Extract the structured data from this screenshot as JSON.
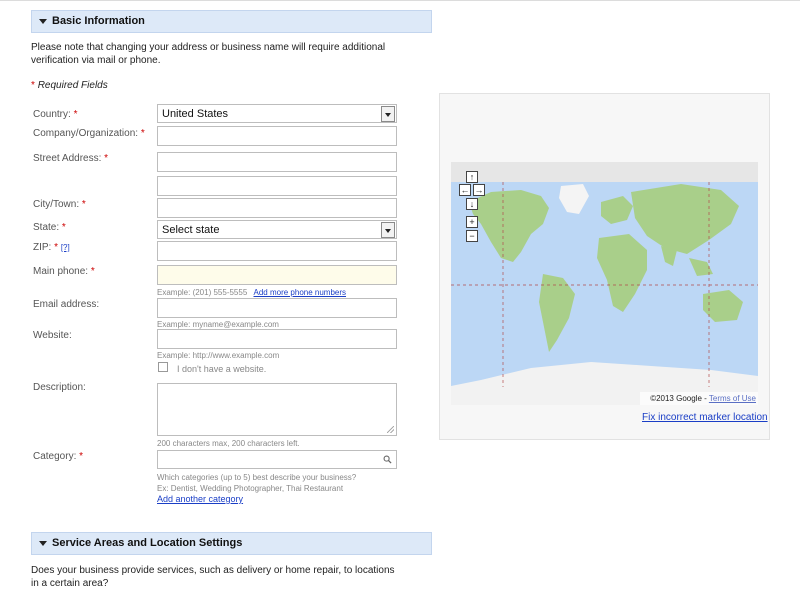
{
  "basic_section": {
    "title": "Basic Information"
  },
  "intro_text_line1": "Please note that changing your address or business name will require additional",
  "intro_text_line2": "verification via mail or phone.",
  "required_note": {
    "asterisk": "*",
    "text": "Required Fields"
  },
  "fields": {
    "country": {
      "label": "Country:",
      "required": "*",
      "value": "United States"
    },
    "company": {
      "label": "Company/Organization:",
      "required": "*"
    },
    "street": {
      "label": "Street Address:",
      "required": "*"
    },
    "city": {
      "label": "City/Town:",
      "required": "*"
    },
    "state": {
      "label": "State:",
      "required": "*",
      "value": "Select state"
    },
    "zip": {
      "label": "ZIP:",
      "required": "*",
      "help": "[?]"
    },
    "main_phone": {
      "label": "Main phone:",
      "required": "*",
      "hint": "Example: (201) 555-5555",
      "link": "Add more phone numbers"
    },
    "email": {
      "label": "Email address:",
      "hint": "Example: myname@example.com"
    },
    "website": {
      "label": "Website:",
      "hint": "Example: http://www.example.com",
      "checkbox_label": "I don't have a website."
    },
    "description": {
      "label": "Description:",
      "hint": "200 characters max, 200 characters left."
    },
    "category": {
      "label": "Category:",
      "required": "*",
      "hint_line1": "Which categories (up to 5) best describe your business?",
      "hint_line2": "Ex: Dentist, Wedding Photographer, Thai Restaurant",
      "link": "Add another category"
    }
  },
  "map": {
    "controls": {
      "up": "↑",
      "left": "←",
      "right": "→",
      "down": "↓",
      "zoom_in": "+",
      "zoom_out": "−"
    },
    "copyright": "©2013 Google -",
    "terms_link": "Terms of Use",
    "fix_link": "Fix incorrect marker location"
  },
  "service_section": {
    "title": "Service Areas and Location Settings"
  },
  "service_text_line1": "Does your business provide services, such as delivery or home repair, to locations",
  "service_text_line2": "in a certain area?",
  "colors": {
    "header_bg": "#dde9f8",
    "link": "#1a3ec6",
    "required": "#cc0000",
    "ocean": "#bcd7f5",
    "land": "#a9cf8a"
  }
}
